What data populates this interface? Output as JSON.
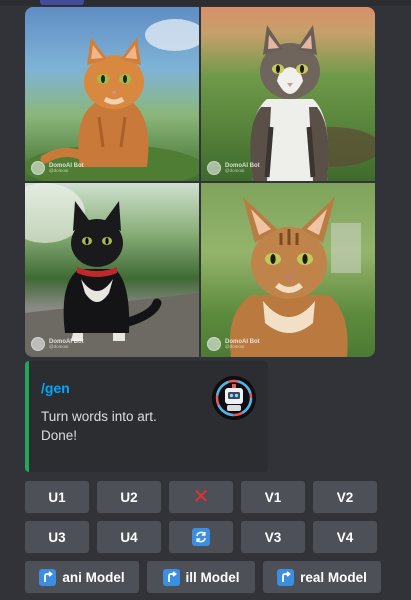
{
  "images": [
    {
      "watermark_name": "DomoAI Bot",
      "watermark_tag": "@domoai"
    },
    {
      "watermark_name": "DomoAI Bot",
      "watermark_tag": "@domoai"
    },
    {
      "watermark_name": "DomoAI Bot",
      "watermark_tag": "@domoai"
    },
    {
      "watermark_name": "DomoAI Bot",
      "watermark_tag": "@domoai"
    }
  ],
  "embed": {
    "title": "/gen",
    "description_line1": "Turn words into art.",
    "description_line2": "Done!",
    "accent_color": "#23a55a",
    "title_color": "#00a8fc",
    "thumbnail_icon": "robot-avatar-icon"
  },
  "buttons": {
    "row1": [
      "U1",
      "U2",
      "",
      "V1",
      "V2"
    ],
    "row2": [
      "U3",
      "U4",
      "",
      "V3",
      "V4"
    ],
    "delete_icon": "cross-mark-icon",
    "reroll_icon": "refresh-icon",
    "models": [
      "ani Model",
      "ill Model",
      "real Model"
    ],
    "model_icon": "arrow-up-right-icon",
    "button_color": "#4e5058"
  }
}
